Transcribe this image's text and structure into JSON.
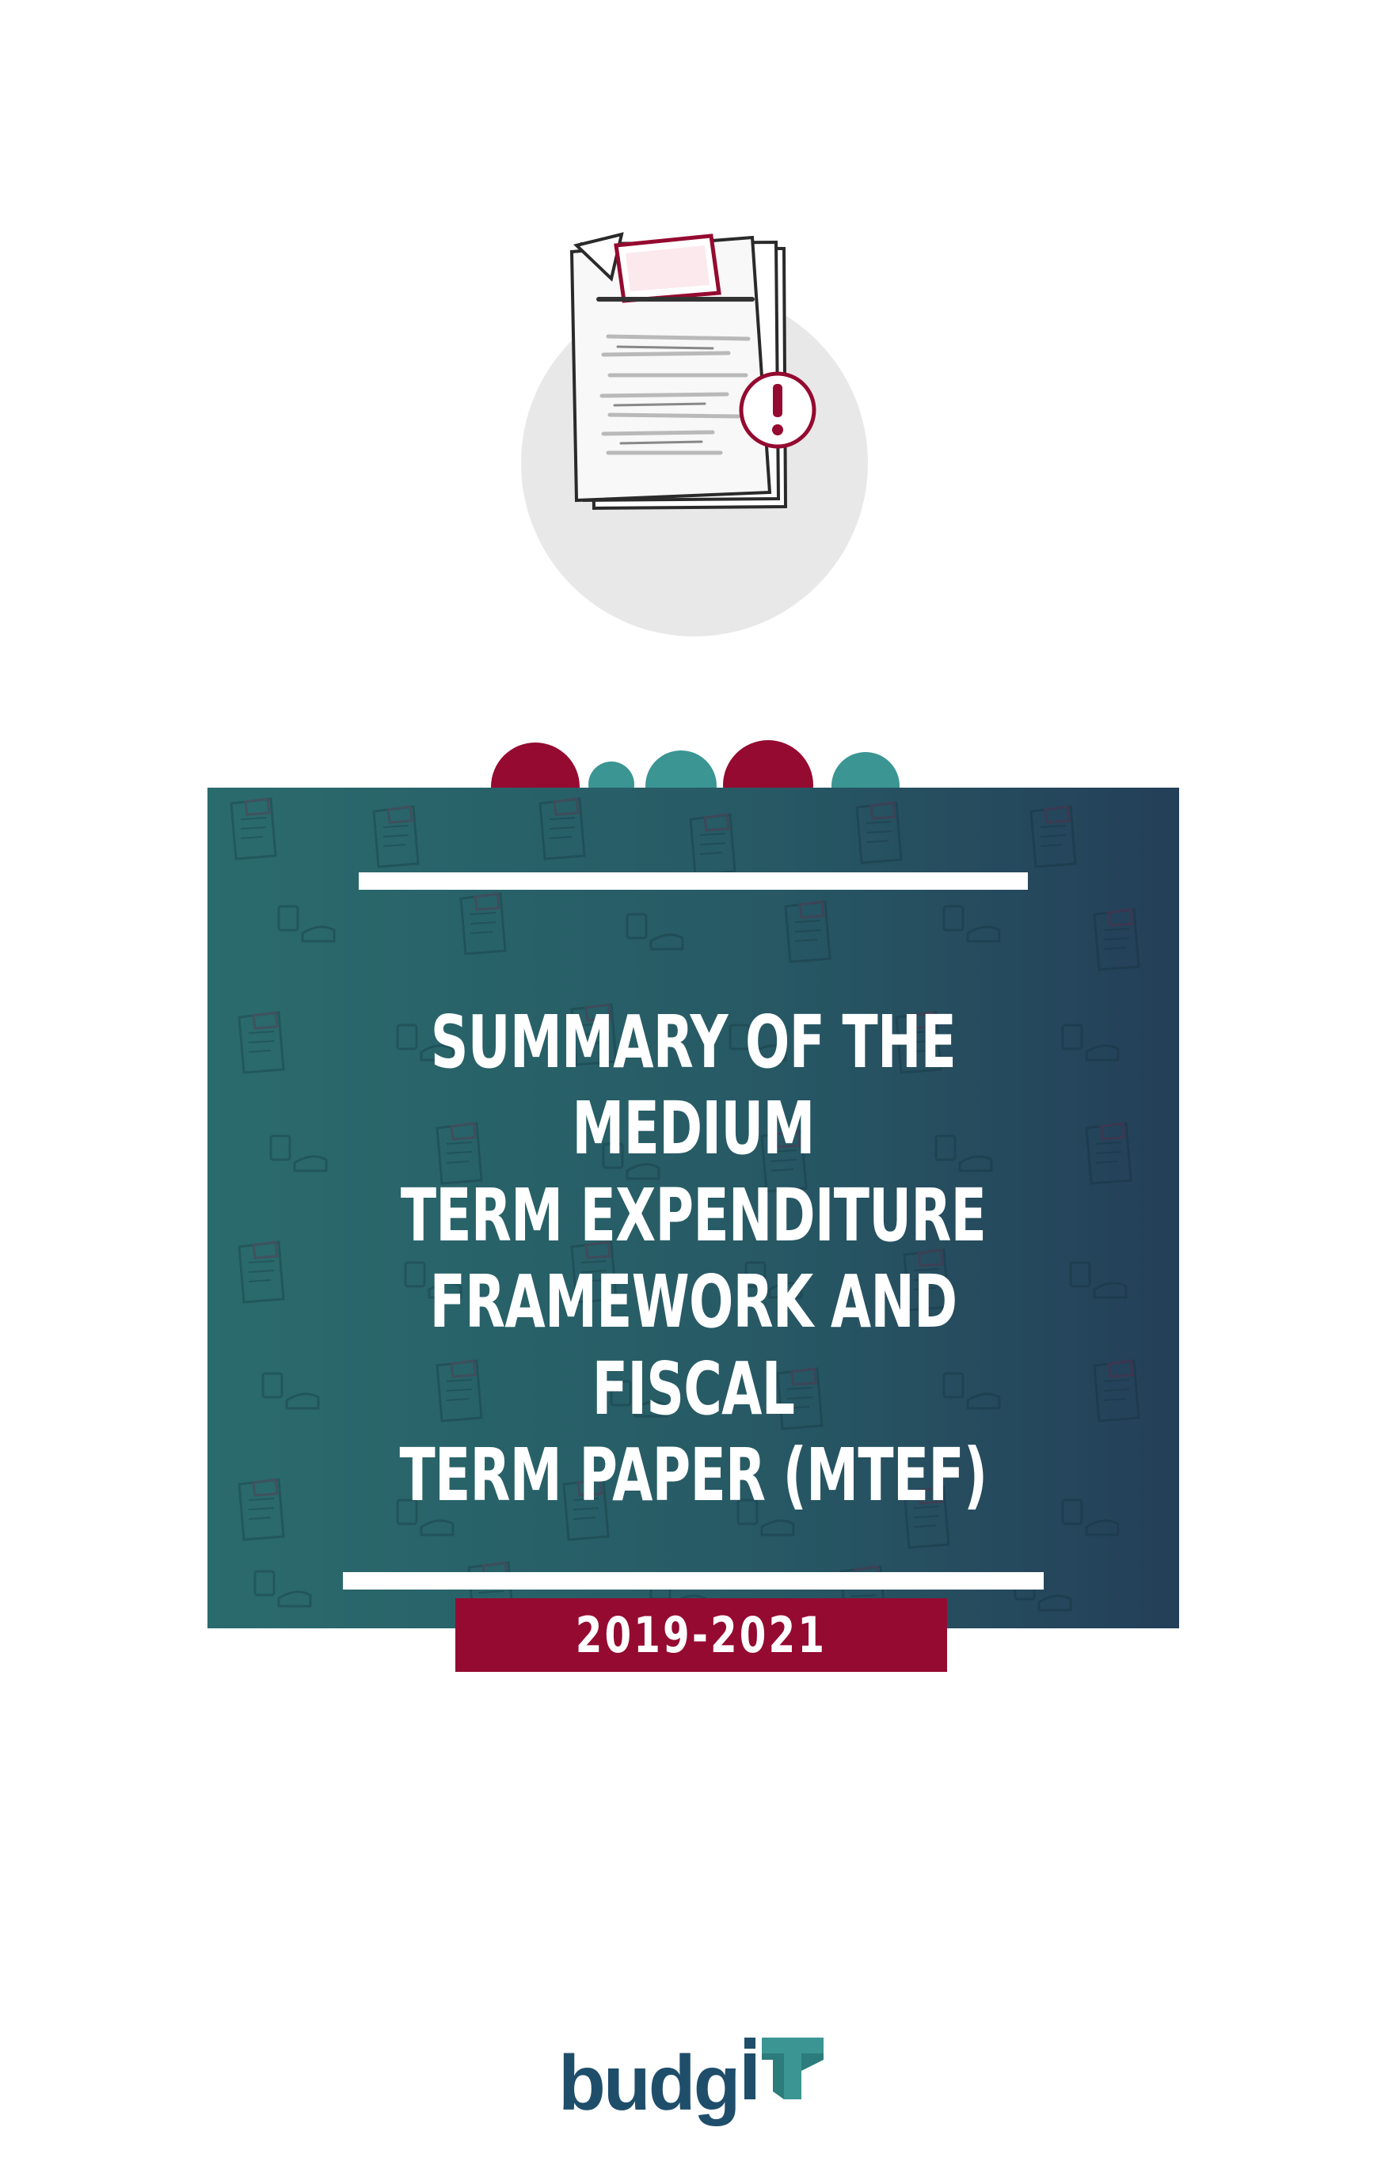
{
  "document": {
    "title_lines": "SUMMARY OF THE MEDIUM\nTERM EXPENDITURE\nFRAMEWORK AND FISCAL\nTERM PAPER (MTEF)",
    "years": "2019-2021"
  },
  "branding": {
    "logo_text": "budgiT"
  },
  "icons": {
    "hero": "document-alert-icon",
    "logo_mark": "budgit-t-mark"
  },
  "colors": {
    "teal": "#2a6b6d",
    "navy": "#243f58",
    "crimson": "#950a30",
    "accent_teal": "#3a9593",
    "circle_grey": "#e9e8e9"
  }
}
